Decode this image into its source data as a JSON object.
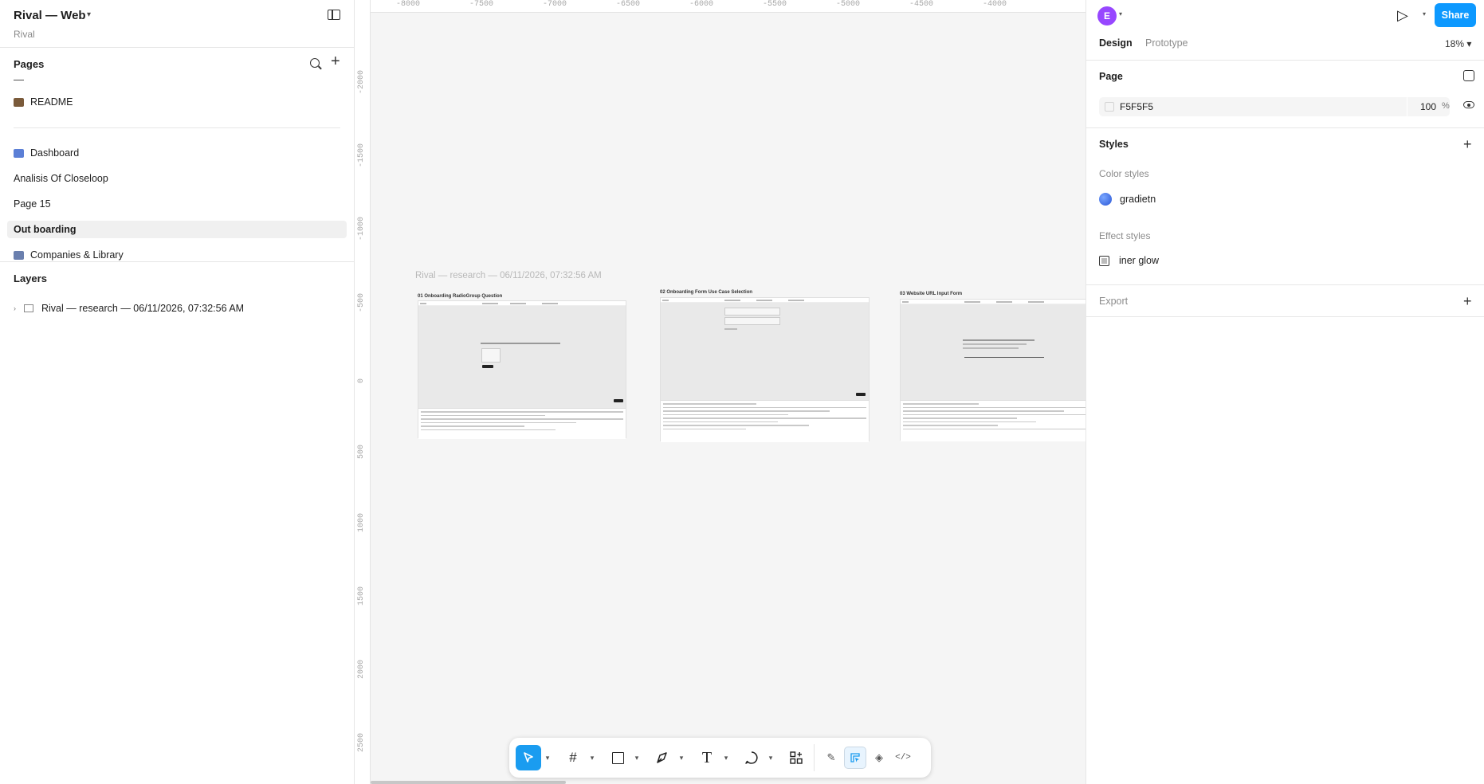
{
  "file": {
    "title": "Rival — Web",
    "project": "Rival"
  },
  "pages": {
    "heading": "Pages",
    "divider": "—",
    "items": [
      {
        "label": "README",
        "icon": "books-emoji",
        "color": "#7a5a3a"
      },
      {
        "label": "Dashboard",
        "icon": "chart-emoji",
        "color": "#5b7fd6"
      },
      {
        "label": "Analisis Of Closeloop"
      },
      {
        "label": "Page 15"
      },
      {
        "label": "Out boarding",
        "active": true
      },
      {
        "label": "Companies & Library",
        "icon": "books-emoji",
        "color": "#6a7fae"
      }
    ]
  },
  "layers": {
    "heading": "Layers",
    "items": [
      {
        "label": "Rival — research — 06/11/2026, 07:32:56 AM"
      }
    ]
  },
  "canvas": {
    "ruler_top": [
      "-8000",
      "-7500",
      "-7000",
      "-6500",
      "-6000",
      "-5500",
      "-5000",
      "-4500",
      "-4000"
    ],
    "ruler_left": [
      "-2000",
      "-1500",
      "-1000",
      "-500",
      "0",
      "500",
      "1000",
      "1500",
      "2000",
      "2500"
    ],
    "section_label": "Rival — research — 06/11/2026, 07:32:56 AM",
    "frames": [
      {
        "title": "01 Onboarding RadioGroup Question"
      },
      {
        "title": "02 Onboarding Form Use Case Selection"
      },
      {
        "title": "03 Website URL Input Form"
      }
    ]
  },
  "toolbar": {
    "tools": [
      "move-tool",
      "frame-tool",
      "shape-tool",
      "pen-tool",
      "text-tool",
      "comment-tool",
      "actions-tool"
    ],
    "modes": [
      "draw-mode",
      "design-mode",
      "dev-mode-component",
      "dev-mode-code"
    ]
  },
  "right": {
    "avatar_initial": "E",
    "share_label": "Share",
    "tabs": [
      "Design",
      "Prototype"
    ],
    "active_tab": "Design",
    "zoom": "18%",
    "page_heading": "Page",
    "page_fill": {
      "hex": "F5F5F5",
      "opacity": "100",
      "unit": "%"
    },
    "styles_heading": "Styles",
    "color_styles_heading": "Color styles",
    "color_styles": [
      {
        "name": "gradietn"
      }
    ],
    "effect_styles_heading": "Effect styles",
    "effect_styles": [
      {
        "name": "iner glow"
      }
    ],
    "export_heading": "Export"
  },
  "help": "?"
}
